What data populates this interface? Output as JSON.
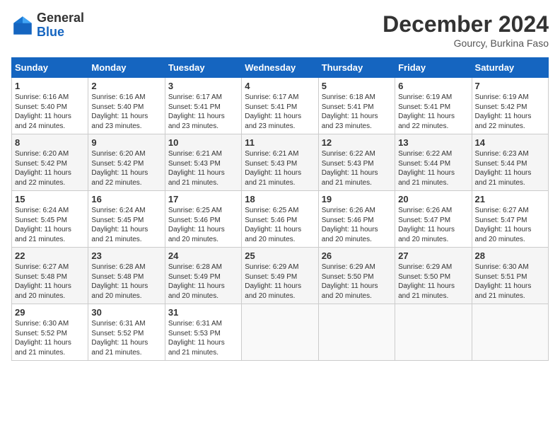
{
  "header": {
    "logo_general": "General",
    "logo_blue": "Blue",
    "title": "December 2024",
    "location": "Gourcy, Burkina Faso"
  },
  "days_of_week": [
    "Sunday",
    "Monday",
    "Tuesday",
    "Wednesday",
    "Thursday",
    "Friday",
    "Saturday"
  ],
  "weeks": [
    [
      {
        "day": "1",
        "text": "Sunrise: 6:16 AM\nSunset: 5:40 PM\nDaylight: 11 hours\nand 24 minutes."
      },
      {
        "day": "2",
        "text": "Sunrise: 6:16 AM\nSunset: 5:40 PM\nDaylight: 11 hours\nand 23 minutes."
      },
      {
        "day": "3",
        "text": "Sunrise: 6:17 AM\nSunset: 5:41 PM\nDaylight: 11 hours\nand 23 minutes."
      },
      {
        "day": "4",
        "text": "Sunrise: 6:17 AM\nSunset: 5:41 PM\nDaylight: 11 hours\nand 23 minutes."
      },
      {
        "day": "5",
        "text": "Sunrise: 6:18 AM\nSunset: 5:41 PM\nDaylight: 11 hours\nand 23 minutes."
      },
      {
        "day": "6",
        "text": "Sunrise: 6:19 AM\nSunset: 5:41 PM\nDaylight: 11 hours\nand 22 minutes."
      },
      {
        "day": "7",
        "text": "Sunrise: 6:19 AM\nSunset: 5:42 PM\nDaylight: 11 hours\nand 22 minutes."
      }
    ],
    [
      {
        "day": "8",
        "text": "Sunrise: 6:20 AM\nSunset: 5:42 PM\nDaylight: 11 hours\nand 22 minutes."
      },
      {
        "day": "9",
        "text": "Sunrise: 6:20 AM\nSunset: 5:42 PM\nDaylight: 11 hours\nand 22 minutes."
      },
      {
        "day": "10",
        "text": "Sunrise: 6:21 AM\nSunset: 5:43 PM\nDaylight: 11 hours\nand 21 minutes."
      },
      {
        "day": "11",
        "text": "Sunrise: 6:21 AM\nSunset: 5:43 PM\nDaylight: 11 hours\nand 21 minutes."
      },
      {
        "day": "12",
        "text": "Sunrise: 6:22 AM\nSunset: 5:43 PM\nDaylight: 11 hours\nand 21 minutes."
      },
      {
        "day": "13",
        "text": "Sunrise: 6:22 AM\nSunset: 5:44 PM\nDaylight: 11 hours\nand 21 minutes."
      },
      {
        "day": "14",
        "text": "Sunrise: 6:23 AM\nSunset: 5:44 PM\nDaylight: 11 hours\nand 21 minutes."
      }
    ],
    [
      {
        "day": "15",
        "text": "Sunrise: 6:24 AM\nSunset: 5:45 PM\nDaylight: 11 hours\nand 21 minutes."
      },
      {
        "day": "16",
        "text": "Sunrise: 6:24 AM\nSunset: 5:45 PM\nDaylight: 11 hours\nand 21 minutes."
      },
      {
        "day": "17",
        "text": "Sunrise: 6:25 AM\nSunset: 5:46 PM\nDaylight: 11 hours\nand 20 minutes."
      },
      {
        "day": "18",
        "text": "Sunrise: 6:25 AM\nSunset: 5:46 PM\nDaylight: 11 hours\nand 20 minutes."
      },
      {
        "day": "19",
        "text": "Sunrise: 6:26 AM\nSunset: 5:46 PM\nDaylight: 11 hours\nand 20 minutes."
      },
      {
        "day": "20",
        "text": "Sunrise: 6:26 AM\nSunset: 5:47 PM\nDaylight: 11 hours\nand 20 minutes."
      },
      {
        "day": "21",
        "text": "Sunrise: 6:27 AM\nSunset: 5:47 PM\nDaylight: 11 hours\nand 20 minutes."
      }
    ],
    [
      {
        "day": "22",
        "text": "Sunrise: 6:27 AM\nSunset: 5:48 PM\nDaylight: 11 hours\nand 20 minutes."
      },
      {
        "day": "23",
        "text": "Sunrise: 6:28 AM\nSunset: 5:48 PM\nDaylight: 11 hours\nand 20 minutes."
      },
      {
        "day": "24",
        "text": "Sunrise: 6:28 AM\nSunset: 5:49 PM\nDaylight: 11 hours\nand 20 minutes."
      },
      {
        "day": "25",
        "text": "Sunrise: 6:29 AM\nSunset: 5:49 PM\nDaylight: 11 hours\nand 20 minutes."
      },
      {
        "day": "26",
        "text": "Sunrise: 6:29 AM\nSunset: 5:50 PM\nDaylight: 11 hours\nand 20 minutes."
      },
      {
        "day": "27",
        "text": "Sunrise: 6:29 AM\nSunset: 5:50 PM\nDaylight: 11 hours\nand 21 minutes."
      },
      {
        "day": "28",
        "text": "Sunrise: 6:30 AM\nSunset: 5:51 PM\nDaylight: 11 hours\nand 21 minutes."
      }
    ],
    [
      {
        "day": "29",
        "text": "Sunrise: 6:30 AM\nSunset: 5:52 PM\nDaylight: 11 hours\nand 21 minutes."
      },
      {
        "day": "30",
        "text": "Sunrise: 6:31 AM\nSunset: 5:52 PM\nDaylight: 11 hours\nand 21 minutes."
      },
      {
        "day": "31",
        "text": "Sunrise: 6:31 AM\nSunset: 5:53 PM\nDaylight: 11 hours\nand 21 minutes."
      },
      {
        "day": "",
        "text": ""
      },
      {
        "day": "",
        "text": ""
      },
      {
        "day": "",
        "text": ""
      },
      {
        "day": "",
        "text": ""
      }
    ]
  ]
}
